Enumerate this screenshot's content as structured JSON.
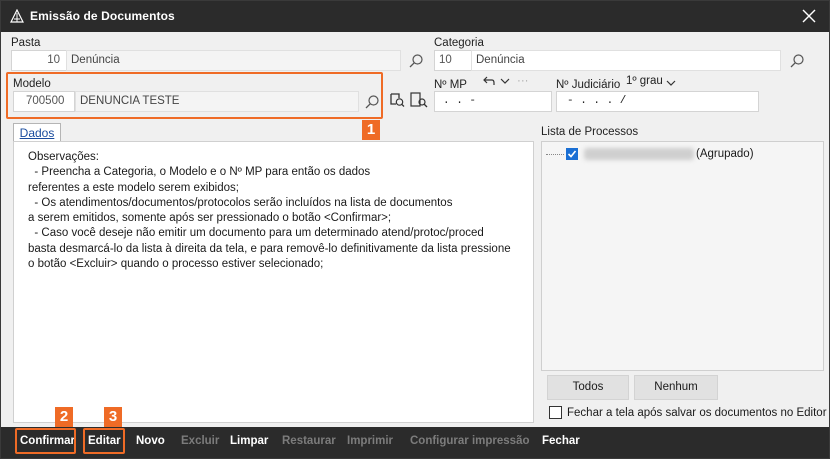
{
  "window": {
    "title": "Emissão de Documentos"
  },
  "pasta": {
    "label": "Pasta",
    "code": "10",
    "description": "Denúncia"
  },
  "categoria": {
    "label": "Categoria",
    "code": "10",
    "description": "Denúncia"
  },
  "modelo": {
    "label": "Modelo",
    "code": "700500",
    "description": "DENUNCIA TESTE"
  },
  "nmp": {
    "label": "Nº MP",
    "value": ".   .       -",
    "extra": "···"
  },
  "njudiciario": {
    "label": "Nº Judiciário",
    "grau": "1º grau",
    "value": "-   .    .   .   /"
  },
  "tab": {
    "label": "Dados"
  },
  "observacoes": [
    "Observações:",
    "  - Preencha a Categoria, o Modelo e o Nº MP para então os dados",
    "referentes a este modelo serem exibidos;",
    "  - Os atendimentos/documentos/protocolos serão incluídos na lista de documentos",
    "a serem emitidos, somente após ser pressionado o botão <Confirmar>;",
    "  - Caso você deseje não emitir um documento para um determinado atend/protoc/proced",
    "basta desmarcá-lo da lista à direita da tela, e para removê-lo definitivamente da lista pressione",
    "o botão <Excluir> quando o processo estiver selecionado;"
  ],
  "processos": {
    "label": "Lista de Processos",
    "items": [
      {
        "suffix": "(Agrupado)",
        "checked": true
      }
    ],
    "todos_label": "Todos",
    "nenhum_label": "Nenhum",
    "fechar_checkbox_label": "Fechar a tela após salvar os documentos no Editor"
  },
  "badges": {
    "b1": "1",
    "b2": "2",
    "b3": "3"
  },
  "toolbar": {
    "confirmar": "Confirmar",
    "editar": "Editar",
    "novo": "Novo",
    "excluir": "Excluir",
    "limpar": "Limpar",
    "restaurar": "Restaurar",
    "imprimir": "Imprimir",
    "configurar": "Configurar impressão",
    "fechar": "Fechar"
  },
  "colors": {
    "accent": "#ef6b26",
    "titlebar": "#2b2b2b",
    "check": "#1a6fd4"
  }
}
